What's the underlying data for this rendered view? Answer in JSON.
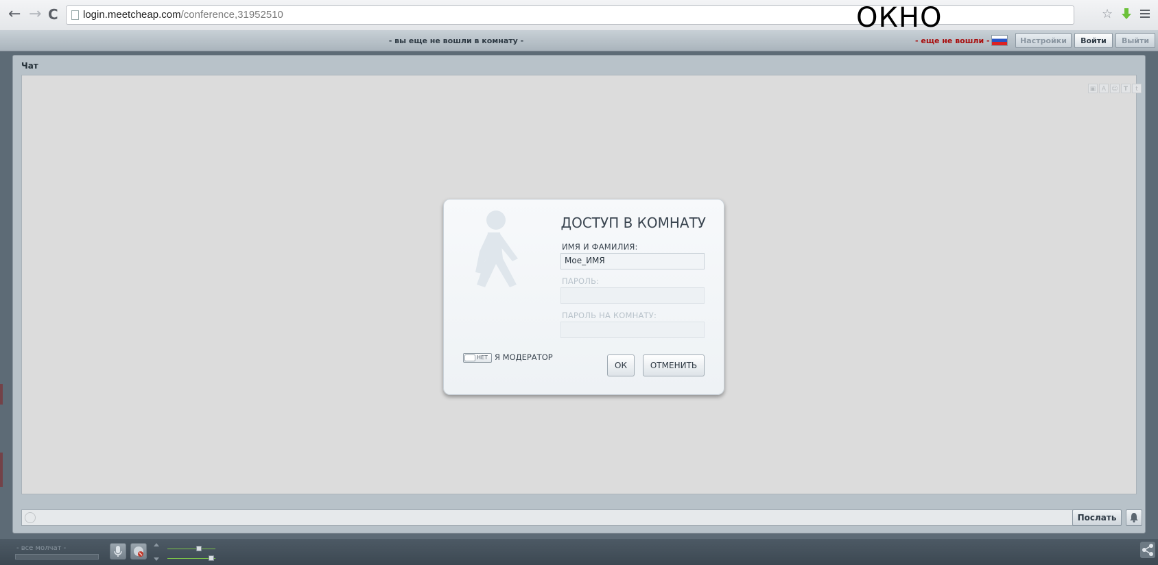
{
  "browser": {
    "url_domain": "login.meetcheap.com",
    "url_path": "/conference,31952510",
    "back_icon": "arrow-left-icon",
    "forward_icon": "arrow-right-icon",
    "reload_icon": "reload-icon",
    "star_icon": "star-icon",
    "extension_icon": "download-extension-icon",
    "menu_icon": "hamburger-menu-icon"
  },
  "overlay_label": "ОКНО",
  "topbar": {
    "room_status": "- вы еще не вошли в комнату -",
    "login_status": "- еще не вошли -",
    "settings_label": "Настройки",
    "login_label": "Войти",
    "logout_label": "Выйти"
  },
  "chat": {
    "title": "Чат",
    "send_label": "Послать"
  },
  "bottombar": {
    "all_silent": "- все молчат -"
  },
  "modal": {
    "title": "ДОСТУП В КОМНАТУ",
    "name_label": "ИМЯ И ФАМИЛИЯ:",
    "name_value": "Мое_ИМЯ",
    "password_label": "ПАРОЛЬ:",
    "room_password_label": "ПАРОЛЬ НА КОМНАТУ:",
    "toggle_state": "НЕТ",
    "moderator_label": "Я МОДЕРАТОР",
    "ok_label": "ОК",
    "cancel_label": "ОТМЕНИТЬ"
  },
  "colors": {
    "login_status": "#a80c0c",
    "chat_background": "#dcdcdc",
    "volume_slider": "#7bc24a"
  }
}
